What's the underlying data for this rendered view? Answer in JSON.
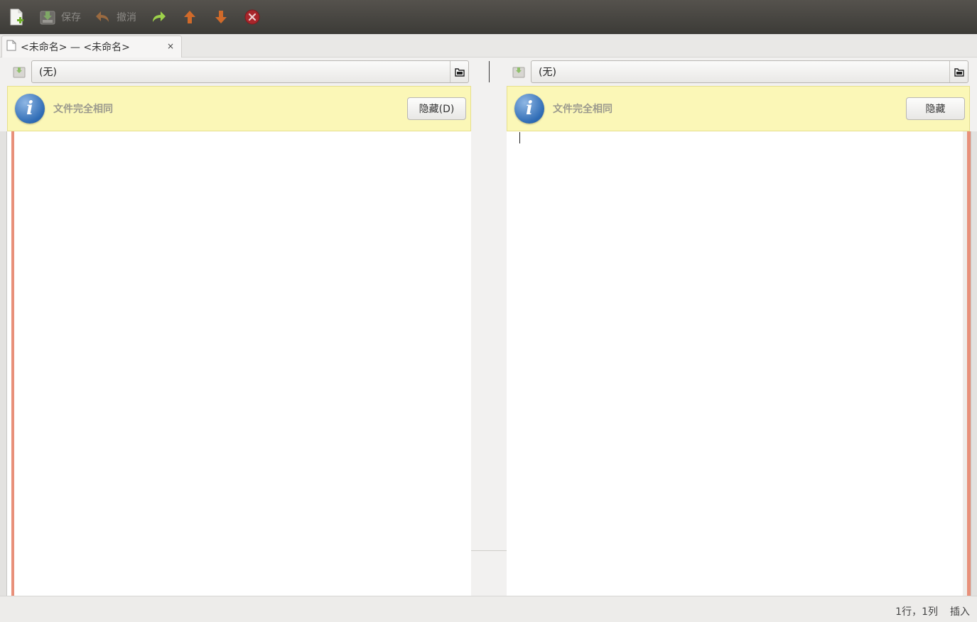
{
  "toolbar": {
    "new_tooltip": "",
    "save_label": "保存",
    "undo_label": "撤消",
    "icons": [
      "new-file-icon",
      "save-icon",
      "undo-icon",
      "redo-icon",
      "up-arrow-icon",
      "down-arrow-icon",
      "stop-icon"
    ]
  },
  "tab": {
    "label": "<未命名> — <未命名>",
    "close": "×"
  },
  "left": {
    "file": "(无)",
    "info_message": "文件完全相同",
    "hide_label": "隐藏(D)"
  },
  "right": {
    "file": "(无)",
    "info_message": "文件完全相同",
    "hide_label": "隐藏"
  },
  "status": {
    "position": "1行，1列",
    "mode": "插入"
  },
  "colors": {
    "toolbar_bg": "#3c3b37",
    "infobar_bg": "#fbf7b7",
    "diff_strip": "#e8907a",
    "info_icon": "#2f6cb5"
  }
}
